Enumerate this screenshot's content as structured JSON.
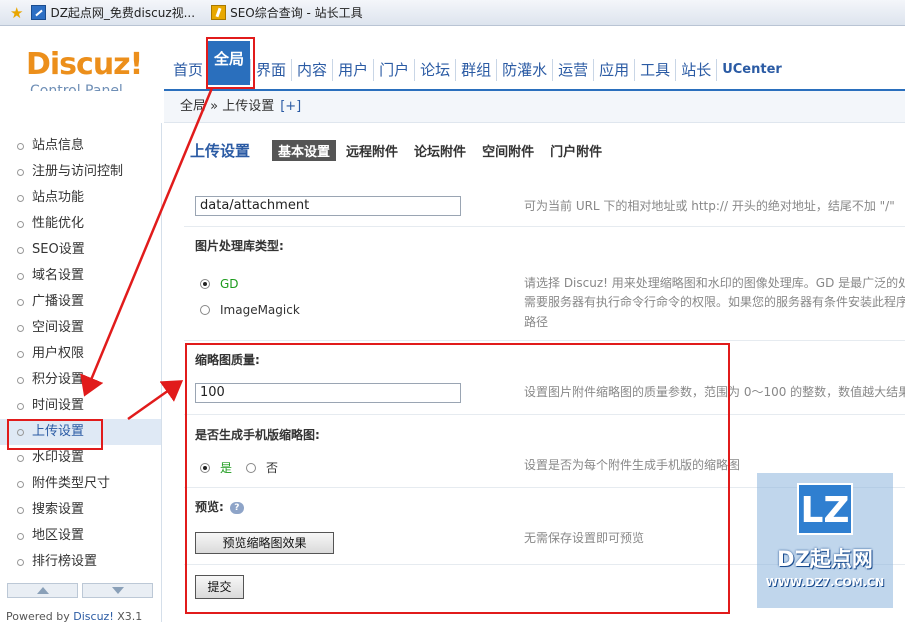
{
  "bookmarks": [
    {
      "label": "DZ起点网_免费discuz视...",
      "icon": "dz-site-icon"
    },
    {
      "label": "SEO综合查询 - 站长工具",
      "icon": "seo-tool-icon"
    }
  ],
  "logo": {
    "main": "Discuz!",
    "sub": "Control Panel"
  },
  "topnav": [
    "首页",
    "全局",
    "界面",
    "内容",
    "用户",
    "门户",
    "论坛",
    "群组",
    "防灌水",
    "运营",
    "应用",
    "工具",
    "站长",
    "UCenter"
  ],
  "topnav_active": "全局",
  "breadcrumb": {
    "text": "全局 » 上传设置",
    "add": "[+]"
  },
  "sidebar": {
    "items": [
      "站点信息",
      "注册与访问控制",
      "站点功能",
      "性能优化",
      "SEO设置",
      "域名设置",
      "广播设置",
      "空间设置",
      "用户权限",
      "积分设置",
      "时间设置",
      "上传设置",
      "水印设置",
      "附件类型尺寸",
      "搜索设置",
      "地区设置",
      "排行榜设置"
    ],
    "active": "上传设置",
    "powered_prefix": "Powered by ",
    "powered_brand": "Discuz!",
    "powered_version": " X3.1"
  },
  "page": {
    "title": "上传设置",
    "tabs": [
      "基本设置",
      "远程附件",
      "论坛附件",
      "空间附件",
      "门户附件"
    ],
    "active_tab": "基本设置"
  },
  "form": {
    "attach_dir": {
      "value": "data/attachment",
      "tip": "可为当前 URL 下的相对地址或 http:// 开头的绝对地址，结尾不加 \"/\""
    },
    "image_lib": {
      "label": "图片处理库类型:",
      "options": [
        "GD",
        "ImageMagick"
      ],
      "selected": "GD",
      "tip_lines": [
        "请选择 Discuz! 用来处理缩略图和水印的图像处理库。GD 是最广泛的处",
        "需要服务器有执行命令行命令的权限。如果您的服务器有条件安装此程序",
        "路径"
      ]
    },
    "thumb_quality": {
      "label": "缩略图质量:",
      "value": "100",
      "tip": "设置图片附件缩略图的质量参数，范围为 0～100 的整数，数值越大结果"
    },
    "mobile_thumb": {
      "label": "是否生成手机版缩略图:",
      "options": [
        "是",
        "否"
      ],
      "selected": "是",
      "tip": "设置是否为每个附件生成手机版的缩略图"
    },
    "preview": {
      "label": "预览:",
      "button": "预览缩略图效果",
      "tip": "无需保存设置即可预览"
    },
    "submit": "提交"
  },
  "watermark": {
    "logo": "LZ",
    "name": "DZ起点网",
    "url": "WWW.DZ7.COM.CN"
  }
}
